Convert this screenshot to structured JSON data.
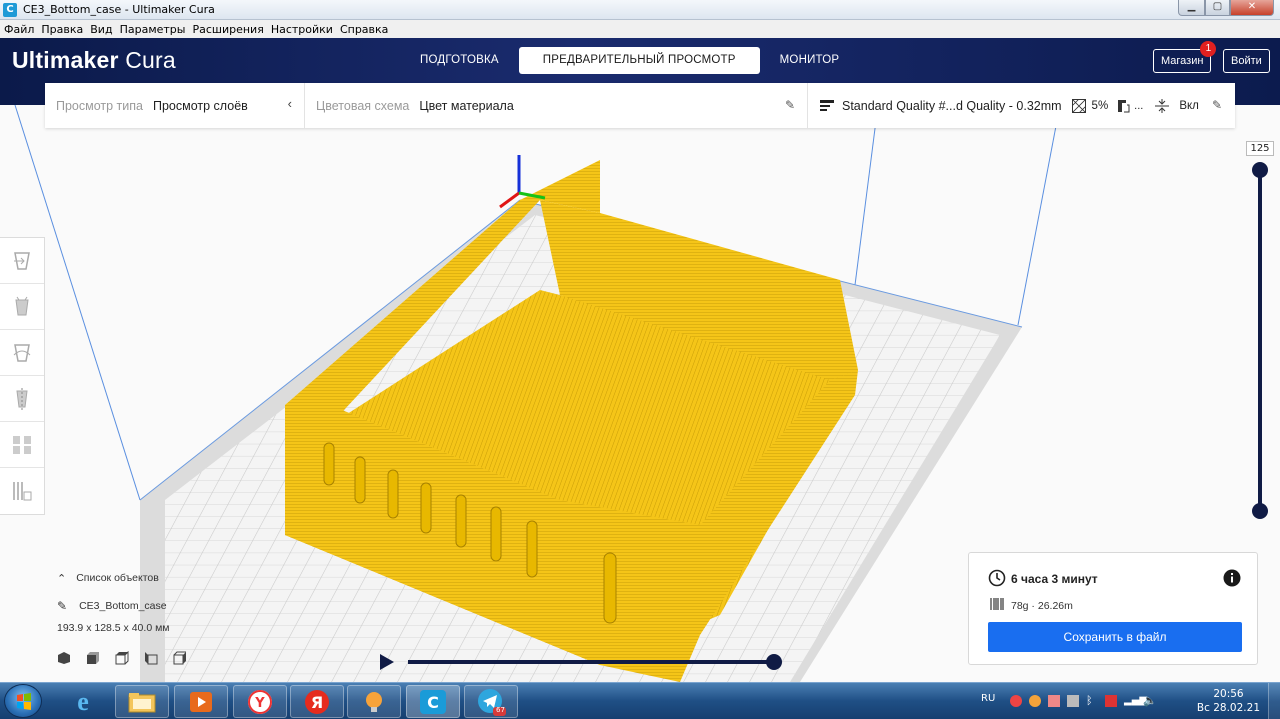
{
  "window": {
    "title": "CE3_Bottom_case - Ultimaker Cura",
    "controls": {
      "minimize": "▁",
      "maximize": "▢",
      "close": "✕"
    }
  },
  "menu": [
    "Файл",
    "Правка",
    "Вид",
    "Параметры",
    "Расширения",
    "Настройки",
    "Справка"
  ],
  "header": {
    "logo_bold": "Ultimaker",
    "logo_light": "Cura",
    "tabs": [
      {
        "label": "ПОДГОТОВКА",
        "active": false
      },
      {
        "label": "ПРЕДВАРИТЕЛЬНЫЙ ПРОСМОТР",
        "active": true
      },
      {
        "label": "МОНИТОР",
        "active": false
      }
    ],
    "marketplace": "Магазин",
    "marketplace_badge": "1",
    "signin": "Войти"
  },
  "strip": {
    "view_type_label": "Просмотр типа",
    "view_type_value": "Просмотр слоёв",
    "color_scheme_label": "Цветовая схема",
    "color_scheme_value": "Цвет материала",
    "profile": "Standard Quality #...d Quality - 0.32mm",
    "infill": "5%",
    "support": "...",
    "adhesion": "Вкл"
  },
  "objects": {
    "title": "Список объектов",
    "name": "CE3_Bottom_case",
    "dimensions": "193.9 x 128.5 x 40.0 мм"
  },
  "layer_slider": {
    "current_layer": "125",
    "fraction": 1.0
  },
  "simulation": {
    "progress": 1.0
  },
  "output": {
    "print_time": "6 часа 3 минут",
    "material": "78g · 26.26m",
    "save_label": "Сохранить в файл"
  },
  "taskbar": {
    "language": "RU",
    "time": "20:56",
    "date": "Вс 28.02.21",
    "telegram_badge": "67"
  },
  "colors": {
    "model": "#f5c518",
    "header_dark": "#0b1a4a",
    "accent_blue": "#196ef0"
  }
}
